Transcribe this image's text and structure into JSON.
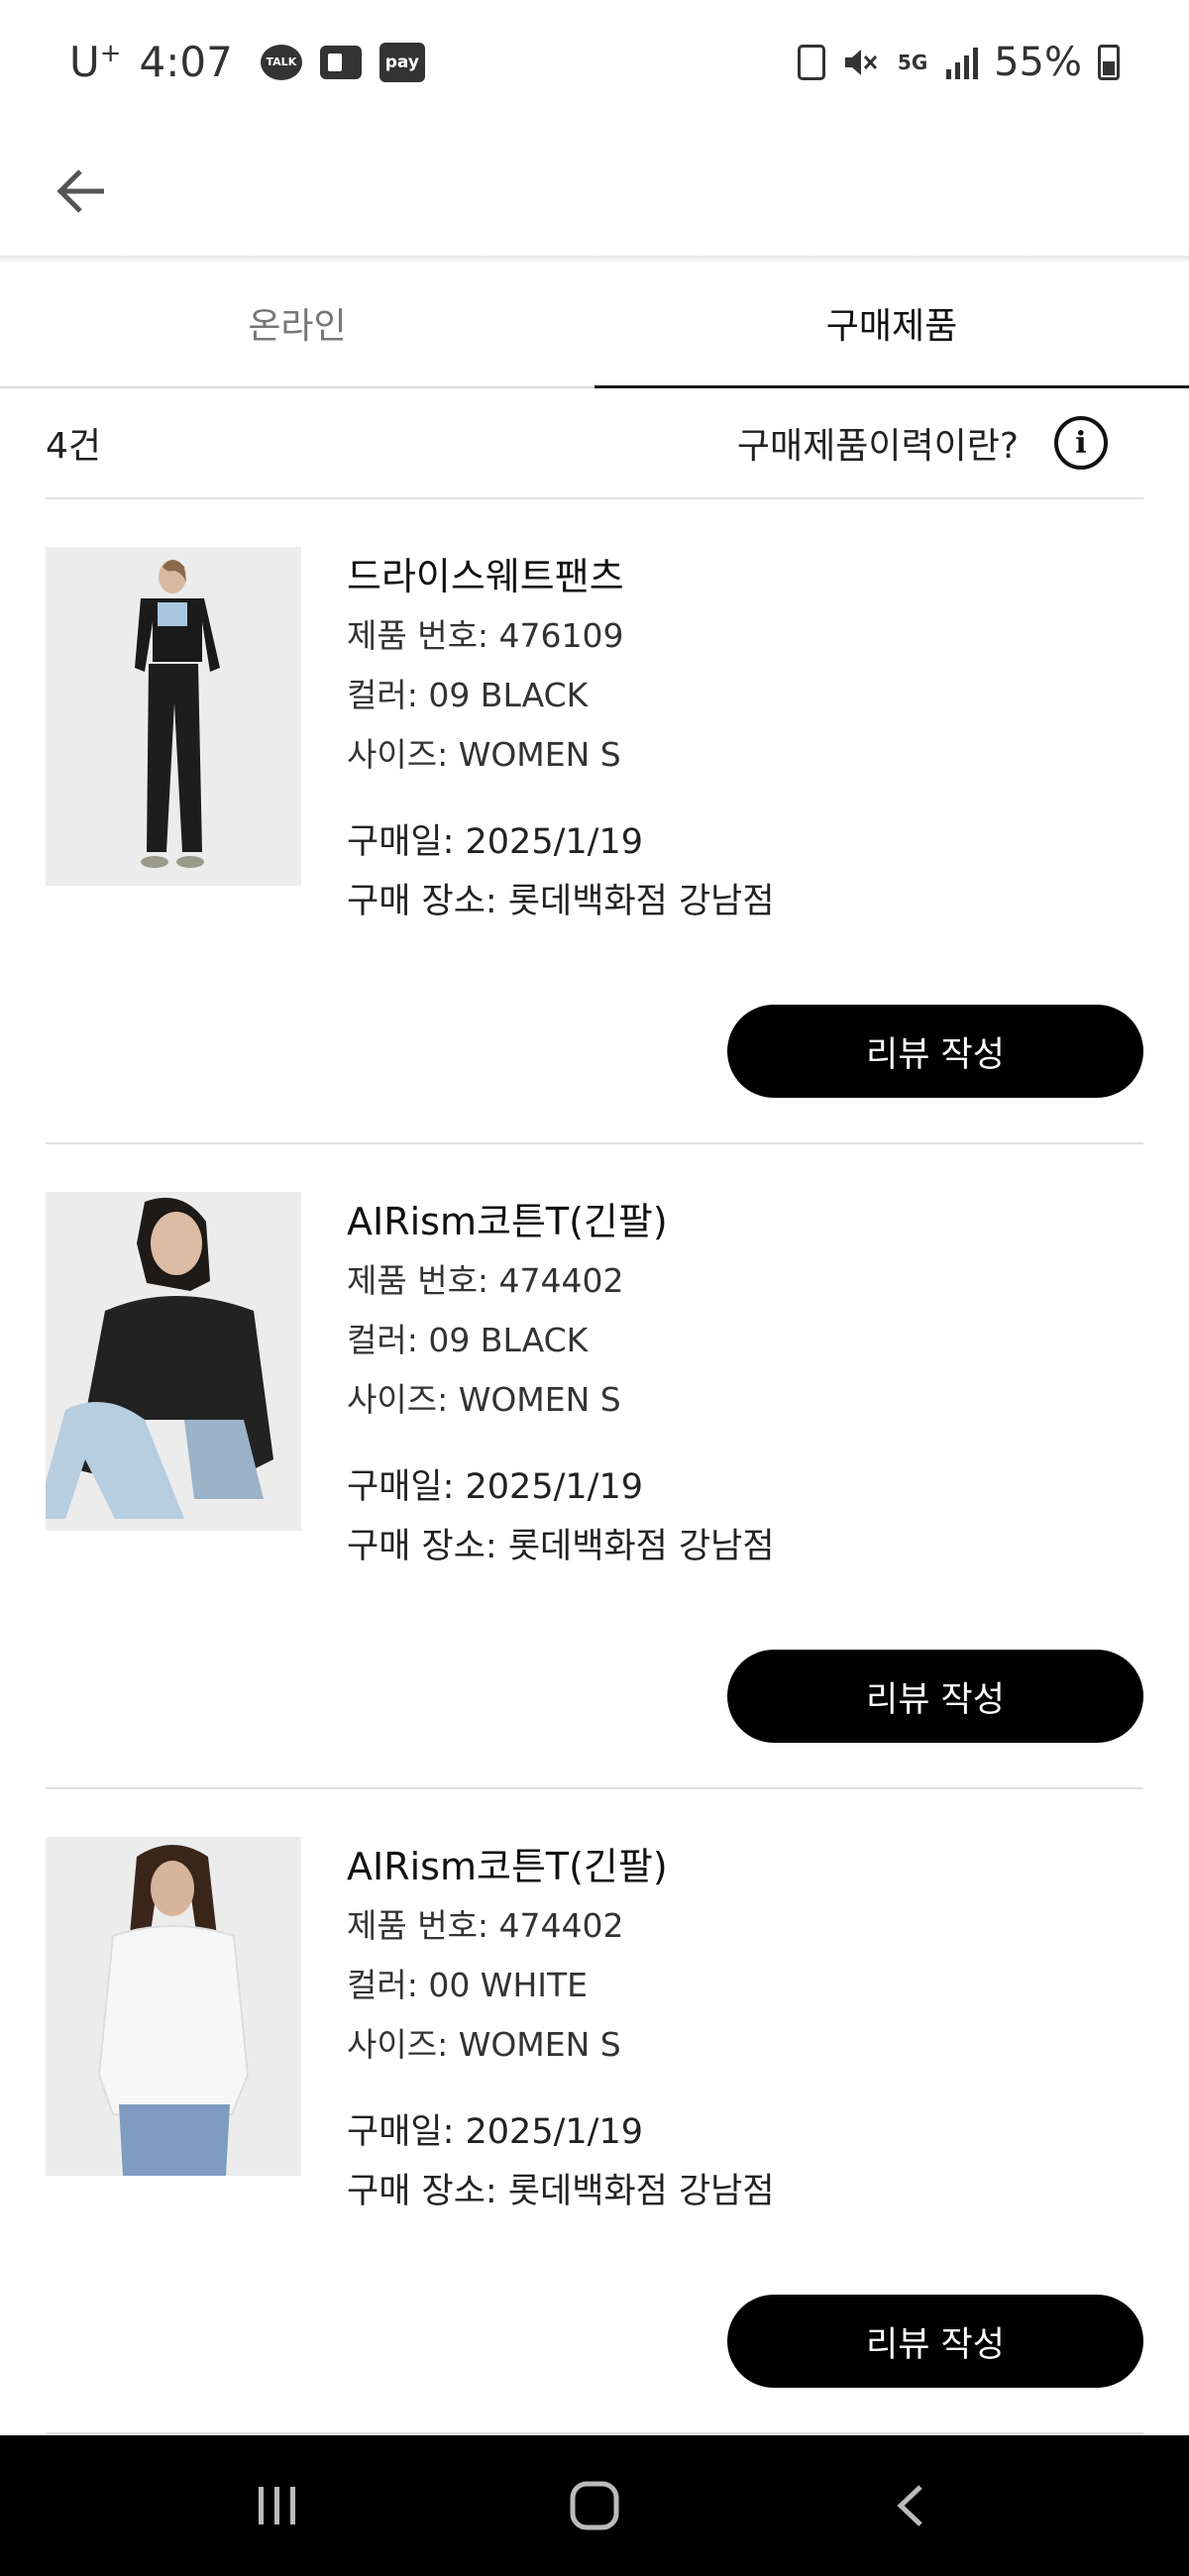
{
  "status_bar": {
    "carrier": "U",
    "carrier_sup": "+",
    "time": "4:07",
    "talk_label": "TALK",
    "pay_label": "pay",
    "network_label": "5G",
    "battery": "55%"
  },
  "tabs": [
    {
      "label": "온라인",
      "active": false
    },
    {
      "label": "구매제품",
      "active": true
    }
  ],
  "summary": {
    "count": "4건",
    "history_link": "구매제품이력이란?",
    "info_glyph": "i"
  },
  "products": [
    {
      "name": "드라이스웨트팬츠",
      "number": "제품 번호: 476109",
      "color": "컬러: 09 BLACK",
      "size": "사이즈: WOMEN S",
      "date": "구매일: 2025/1/19",
      "store": "구매 장소: 롯데백화점 강남점",
      "review_label": "리뷰 작성",
      "image_icon": "woman-black-jacket-pants-photo"
    },
    {
      "name": "AIRism코튼T(긴팔)",
      "number": "제품 번호: 474402",
      "color": "컬러: 09 BLACK",
      "size": "사이즈: WOMEN S",
      "date": "구매일: 2025/1/19",
      "store": "구매 장소: 롯데백화점 강남점",
      "review_label": "리뷰 작성",
      "image_icon": "woman-black-longsleeve-photo"
    },
    {
      "name": "AIRism코튼T(긴팔)",
      "number": "제품 번호: 474402",
      "color": "컬러: 00 WHITE",
      "size": "사이즈: WOMEN S",
      "date": "구매일: 2025/1/19",
      "store": "구매 장소: 롯데백화점 강남점",
      "review_label": "리뷰 작성",
      "image_icon": "woman-white-longsleeve-photo"
    }
  ],
  "colors": {
    "accent": "#000000",
    "text": "#111111",
    "muted": "#777777",
    "divider": "#e2e2e2",
    "navbar": "#000000"
  }
}
